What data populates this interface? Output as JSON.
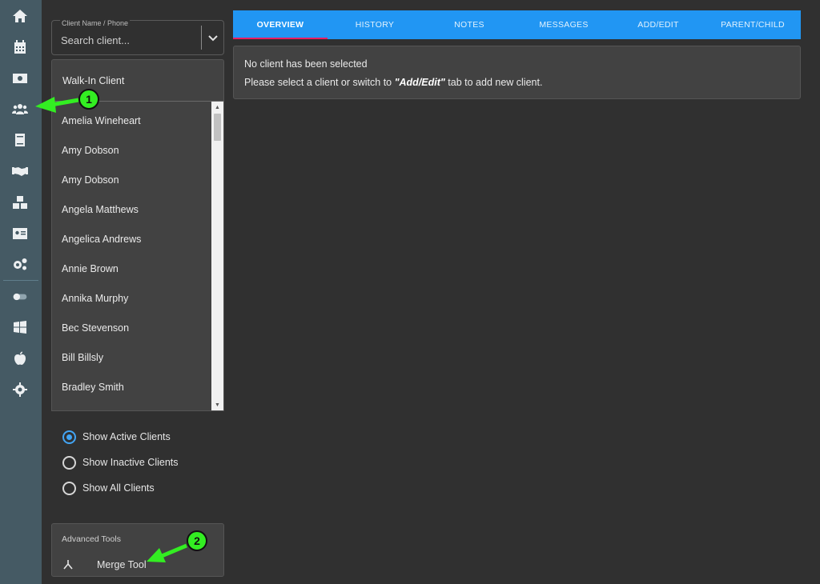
{
  "rail": {
    "icons": [
      "home-icon",
      "calendar-icon",
      "money-icon",
      "users-icon",
      "book-icon",
      "handshake-icon",
      "cubes-icon",
      "id-card-icon",
      "cogs-icon",
      "toggle-icon",
      "windows-icon",
      "apple-icon",
      "settings-icon"
    ]
  },
  "search": {
    "label": "Client Name / Phone",
    "placeholder": "Search client..."
  },
  "clients": {
    "walk_in": "Walk-In Client",
    "items": [
      "Amelia Wineheart",
      "Amy Dobson",
      "Amy Dobson",
      "Angela Matthews",
      "Angelica Andrews",
      "Annie Brown",
      "Annika Murphy",
      "Bec Stevenson",
      "Bill Billsly",
      "Bradley Smith"
    ]
  },
  "filters": {
    "active": "Show Active Clients",
    "inactive": "Show Inactive Clients",
    "all": "Show All Clients",
    "selected": "Show Active Clients"
  },
  "advanced": {
    "title": "Advanced Tools",
    "merge": "Merge Tool"
  },
  "tabs": [
    "OVERVIEW",
    "HISTORY",
    "NOTES",
    "MESSAGES",
    "ADD/EDIT",
    "PARENT/CHILD"
  ],
  "active_tab": "OVERVIEW",
  "message": {
    "line1": "No client has been selected",
    "line2_prefix": "Please select a client or switch to ",
    "line2_emphasis": "\"Add/Edit\"",
    "line2_suffix": " tab to add new client."
  },
  "annotations": [
    "1",
    "2"
  ],
  "colors": {
    "rail": "#455a64",
    "tab_bar": "#2196f3",
    "tab_indicator": "#e91e63",
    "radio_selected": "#42a5f5",
    "annotation": "#33ee22"
  }
}
